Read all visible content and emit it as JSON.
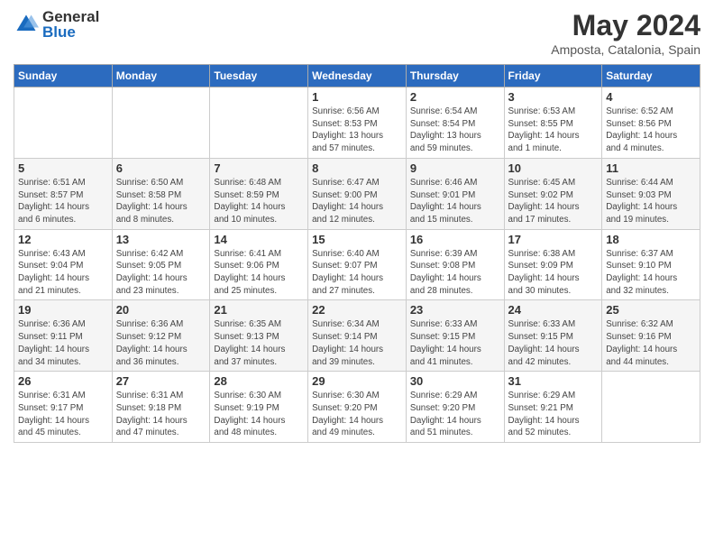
{
  "header": {
    "logo": {
      "general": "General",
      "blue": "Blue"
    },
    "title": "May 2024",
    "location": "Amposta, Catalonia, Spain"
  },
  "weekdays": [
    "Sunday",
    "Monday",
    "Tuesday",
    "Wednesday",
    "Thursday",
    "Friday",
    "Saturday"
  ],
  "weeks": [
    [
      {
        "day": "",
        "info": ""
      },
      {
        "day": "",
        "info": ""
      },
      {
        "day": "",
        "info": ""
      },
      {
        "day": "1",
        "info": "Sunrise: 6:56 AM\nSunset: 8:53 PM\nDaylight: 13 hours\nand 57 minutes."
      },
      {
        "day": "2",
        "info": "Sunrise: 6:54 AM\nSunset: 8:54 PM\nDaylight: 13 hours\nand 59 minutes."
      },
      {
        "day": "3",
        "info": "Sunrise: 6:53 AM\nSunset: 8:55 PM\nDaylight: 14 hours\nand 1 minute."
      },
      {
        "day": "4",
        "info": "Sunrise: 6:52 AM\nSunset: 8:56 PM\nDaylight: 14 hours\nand 4 minutes."
      }
    ],
    [
      {
        "day": "5",
        "info": "Sunrise: 6:51 AM\nSunset: 8:57 PM\nDaylight: 14 hours\nand 6 minutes."
      },
      {
        "day": "6",
        "info": "Sunrise: 6:50 AM\nSunset: 8:58 PM\nDaylight: 14 hours\nand 8 minutes."
      },
      {
        "day": "7",
        "info": "Sunrise: 6:48 AM\nSunset: 8:59 PM\nDaylight: 14 hours\nand 10 minutes."
      },
      {
        "day": "8",
        "info": "Sunrise: 6:47 AM\nSunset: 9:00 PM\nDaylight: 14 hours\nand 12 minutes."
      },
      {
        "day": "9",
        "info": "Sunrise: 6:46 AM\nSunset: 9:01 PM\nDaylight: 14 hours\nand 15 minutes."
      },
      {
        "day": "10",
        "info": "Sunrise: 6:45 AM\nSunset: 9:02 PM\nDaylight: 14 hours\nand 17 minutes."
      },
      {
        "day": "11",
        "info": "Sunrise: 6:44 AM\nSunset: 9:03 PM\nDaylight: 14 hours\nand 19 minutes."
      }
    ],
    [
      {
        "day": "12",
        "info": "Sunrise: 6:43 AM\nSunset: 9:04 PM\nDaylight: 14 hours\nand 21 minutes."
      },
      {
        "day": "13",
        "info": "Sunrise: 6:42 AM\nSunset: 9:05 PM\nDaylight: 14 hours\nand 23 minutes."
      },
      {
        "day": "14",
        "info": "Sunrise: 6:41 AM\nSunset: 9:06 PM\nDaylight: 14 hours\nand 25 minutes."
      },
      {
        "day": "15",
        "info": "Sunrise: 6:40 AM\nSunset: 9:07 PM\nDaylight: 14 hours\nand 27 minutes."
      },
      {
        "day": "16",
        "info": "Sunrise: 6:39 AM\nSunset: 9:08 PM\nDaylight: 14 hours\nand 28 minutes."
      },
      {
        "day": "17",
        "info": "Sunrise: 6:38 AM\nSunset: 9:09 PM\nDaylight: 14 hours\nand 30 minutes."
      },
      {
        "day": "18",
        "info": "Sunrise: 6:37 AM\nSunset: 9:10 PM\nDaylight: 14 hours\nand 32 minutes."
      }
    ],
    [
      {
        "day": "19",
        "info": "Sunrise: 6:36 AM\nSunset: 9:11 PM\nDaylight: 14 hours\nand 34 minutes."
      },
      {
        "day": "20",
        "info": "Sunrise: 6:36 AM\nSunset: 9:12 PM\nDaylight: 14 hours\nand 36 minutes."
      },
      {
        "day": "21",
        "info": "Sunrise: 6:35 AM\nSunset: 9:13 PM\nDaylight: 14 hours\nand 37 minutes."
      },
      {
        "day": "22",
        "info": "Sunrise: 6:34 AM\nSunset: 9:14 PM\nDaylight: 14 hours\nand 39 minutes."
      },
      {
        "day": "23",
        "info": "Sunrise: 6:33 AM\nSunset: 9:15 PM\nDaylight: 14 hours\nand 41 minutes."
      },
      {
        "day": "24",
        "info": "Sunrise: 6:33 AM\nSunset: 9:15 PM\nDaylight: 14 hours\nand 42 minutes."
      },
      {
        "day": "25",
        "info": "Sunrise: 6:32 AM\nSunset: 9:16 PM\nDaylight: 14 hours\nand 44 minutes."
      }
    ],
    [
      {
        "day": "26",
        "info": "Sunrise: 6:31 AM\nSunset: 9:17 PM\nDaylight: 14 hours\nand 45 minutes."
      },
      {
        "day": "27",
        "info": "Sunrise: 6:31 AM\nSunset: 9:18 PM\nDaylight: 14 hours\nand 47 minutes."
      },
      {
        "day": "28",
        "info": "Sunrise: 6:30 AM\nSunset: 9:19 PM\nDaylight: 14 hours\nand 48 minutes."
      },
      {
        "day": "29",
        "info": "Sunrise: 6:30 AM\nSunset: 9:20 PM\nDaylight: 14 hours\nand 49 minutes."
      },
      {
        "day": "30",
        "info": "Sunrise: 6:29 AM\nSunset: 9:20 PM\nDaylight: 14 hours\nand 51 minutes."
      },
      {
        "day": "31",
        "info": "Sunrise: 6:29 AM\nSunset: 9:21 PM\nDaylight: 14 hours\nand 52 minutes."
      },
      {
        "day": "",
        "info": ""
      }
    ]
  ]
}
